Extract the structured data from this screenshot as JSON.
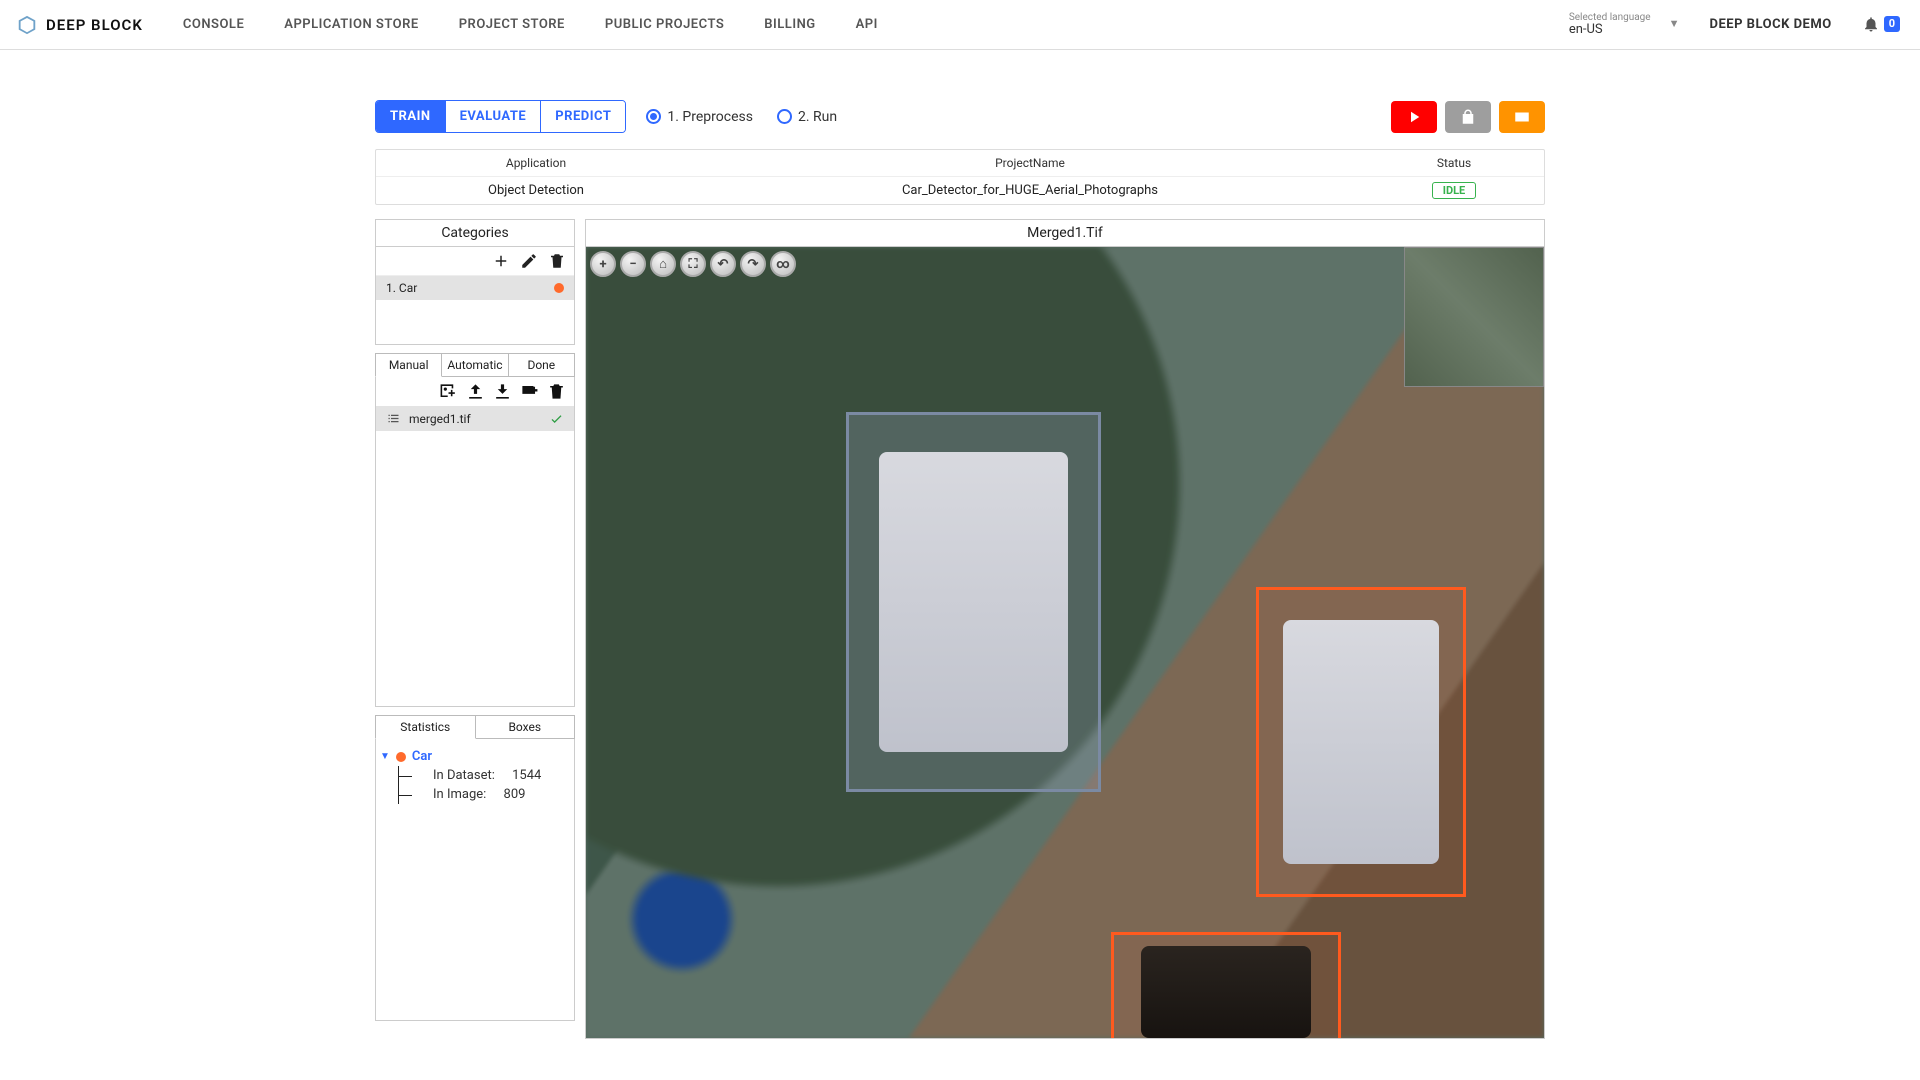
{
  "brand": "DEEP BLOCK",
  "nav": [
    "CONSOLE",
    "APPLICATION STORE",
    "PROJECT STORE",
    "PUBLIC PROJECTS",
    "BILLING",
    "API"
  ],
  "language": {
    "label": "Selected language",
    "value": "en-US"
  },
  "user": "DEEP BLOCK DEMO",
  "notifications": "0",
  "mode_tabs": {
    "train": "TRAIN",
    "evaluate": "EVALUATE",
    "predict": "PREDICT",
    "active": "train"
  },
  "steps": {
    "preprocess": "1. Preprocess",
    "run": "2. Run",
    "active": "preprocess"
  },
  "project": {
    "headers": {
      "application": "Application",
      "project_name": "ProjectName",
      "status": "Status"
    },
    "application": "Object Detection",
    "name": "Car_Detector_for_HUGE_Aerial_Photographs",
    "status": "IDLE"
  },
  "categories": {
    "title": "Categories",
    "items": [
      {
        "index": "1",
        "name": "Car",
        "color": "#ff6a2c"
      }
    ]
  },
  "files": {
    "tabs": {
      "manual": "Manual",
      "automatic": "Automatic",
      "done": "Done",
      "active": "manual"
    },
    "items": [
      {
        "name": "merged1.tif",
        "ok": true
      }
    ]
  },
  "canvas": {
    "title": "Merged1.Tif"
  },
  "stats": {
    "tabs": {
      "statistics": "Statistics",
      "boxes": "Boxes",
      "active": "statistics"
    },
    "class_name": "Car",
    "in_dataset_label": "In Dataset:",
    "in_dataset_value": "1544",
    "in_image_label": "In Image:",
    "in_image_value": "809"
  }
}
